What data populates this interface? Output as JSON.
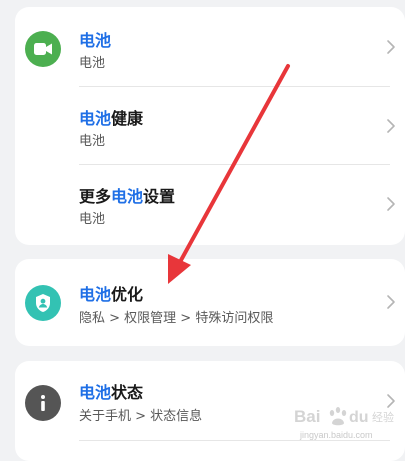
{
  "card1": {
    "rows": [
      {
        "title_hl": "电池",
        "title_rest": "",
        "subtitle": "电池",
        "icon": "video-camera-icon",
        "icon_color": "#4caf50"
      },
      {
        "title_hl": "电池",
        "title_rest": "健康",
        "subtitle": "电池"
      },
      {
        "title_pre": "更多",
        "title_hl": "电池",
        "title_rest": "设置",
        "subtitle": "电池"
      }
    ]
  },
  "card2": {
    "rows": [
      {
        "title_hl": "电池",
        "title_rest": "优化",
        "subtitle": "隐私 > 权限管理 > 特殊访问权限",
        "icon": "shield-person-icon",
        "icon_color": "#33c2b3"
      }
    ]
  },
  "card3": {
    "rows": [
      {
        "title_hl": "电池",
        "title_rest": "状态",
        "subtitle": "关于手机 > 状态信息",
        "icon": "info-icon",
        "icon_color": "#555555"
      }
    ]
  },
  "colors": {
    "highlight": "#1f6fe6",
    "annotation_arrow": "#e8363a"
  },
  "watermark": {
    "brand": "Baidu 经验",
    "url": "jingyan.baidu.com"
  }
}
